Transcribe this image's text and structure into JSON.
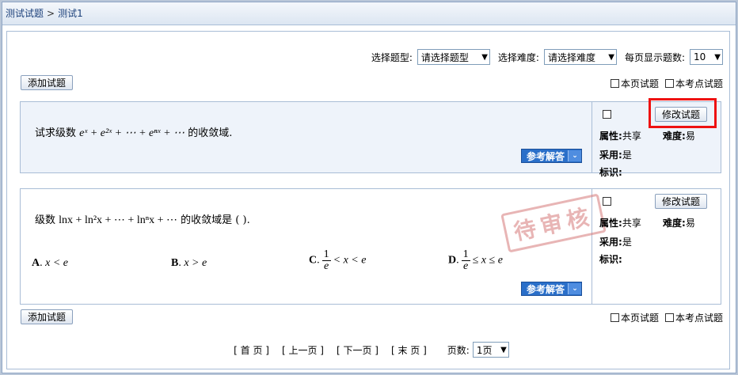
{
  "breadcrumb": {
    "root": "测试试题",
    "separator": ">",
    "current": "测试1"
  },
  "filters": {
    "type_label": "选择题型:",
    "type_value": "请选择题型",
    "difficulty_label": "选择难度:",
    "difficulty_value": "请选择难度",
    "per_page_label": "每页显示题数:",
    "per_page_value": "10"
  },
  "toolbar": {
    "add_label": "添加试题",
    "this_page_label": "本页试题",
    "this_point_label": "本考点试题"
  },
  "questions": [
    {
      "text_prefix": "试求级数",
      "formula": "eˣ + e²ˣ + ⋯ + eⁿˣ + ⋯",
      "text_suffix": "的收敛域.",
      "answer_label": "参考解答",
      "edit_label": "修改试题",
      "attr_label": "属性:",
      "attr_value": "共享",
      "difficulty_label": "难度:",
      "difficulty_value": "易",
      "adopt_label": "采用:",
      "adopt_value": "是",
      "tag_label": "标识:",
      "tag_value": ""
    },
    {
      "text_prefix": "级数",
      "formula": "lnx + ln²x + ⋯ + lnⁿx + ⋯",
      "text_suffix": "的收敛域是 ( ).",
      "stamp": "待审核",
      "options": [
        {
          "letter": "A",
          "expr": "x < e"
        },
        {
          "letter": "B",
          "expr": "x > e"
        },
        {
          "letter": "C",
          "num": "1",
          "den": "e",
          "expr": "< x < e"
        },
        {
          "letter": "D",
          "num": "1",
          "den": "e",
          "expr": "≤ x ≤ e"
        }
      ],
      "answer_label": "参考解答",
      "edit_label": "修改试题",
      "attr_label": "属性:",
      "attr_value": "共享",
      "difficulty_label": "难度:",
      "difficulty_value": "易",
      "adopt_label": "采用:",
      "adopt_value": "是",
      "tag_label": "标识:",
      "tag_value": ""
    }
  ],
  "pager": {
    "first": "[ 首 页 ]",
    "prev": "[ 上一页 ]",
    "next": "[ 下一页 ]",
    "last": "[ 末 页 ]",
    "page_label": "页数:",
    "page_value": "1页"
  },
  "colors": {
    "highlight": "#ee1111",
    "answer_button": "#2a6fc9",
    "stamp": "#d67878"
  }
}
